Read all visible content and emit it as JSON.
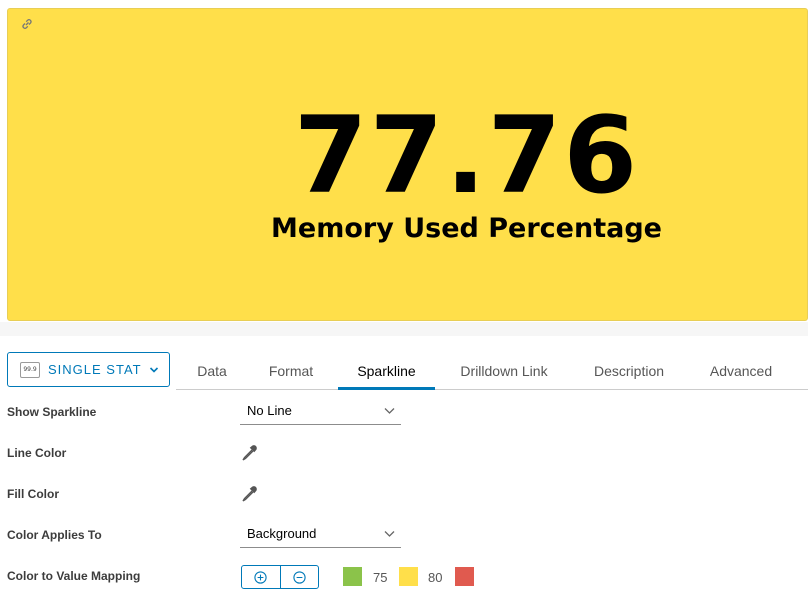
{
  "stat": {
    "value": "77.76",
    "label": "Memory Used Percentage",
    "background_color": "#ffdf4a",
    "link_icon": "link-icon"
  },
  "widget_selector": {
    "thumb_text": "99.9",
    "label": "SINGLE STAT",
    "icon": "chevron-down-icon"
  },
  "tabs": [
    {
      "label": "Data",
      "active": false
    },
    {
      "label": "Format",
      "active": false
    },
    {
      "label": "Sparkline",
      "active": true
    },
    {
      "label": "Drilldown Link",
      "active": false
    },
    {
      "label": "Description",
      "active": false
    },
    {
      "label": "Advanced",
      "active": false
    }
  ],
  "form": {
    "show_sparkline": {
      "label": "Show Sparkline",
      "value": "No Line"
    },
    "line_color": {
      "label": "Line Color",
      "icon": "eyedropper-icon"
    },
    "fill_color": {
      "label": "Fill Color",
      "icon": "eyedropper-icon"
    },
    "color_applies_to": {
      "label": "Color Applies To",
      "value": "Background"
    },
    "color_mapping": {
      "label": "Color to Value Mapping",
      "add_icon": "plus-circle-icon",
      "remove_icon": "minus-circle-icon",
      "swatches": [
        {
          "color": "#8bc34a"
        },
        {
          "threshold": "75",
          "color": "#ffdf4a"
        },
        {
          "threshold": "80",
          "color": "#e05a4f"
        }
      ]
    }
  },
  "colors": {
    "accent": "#0079b8"
  }
}
